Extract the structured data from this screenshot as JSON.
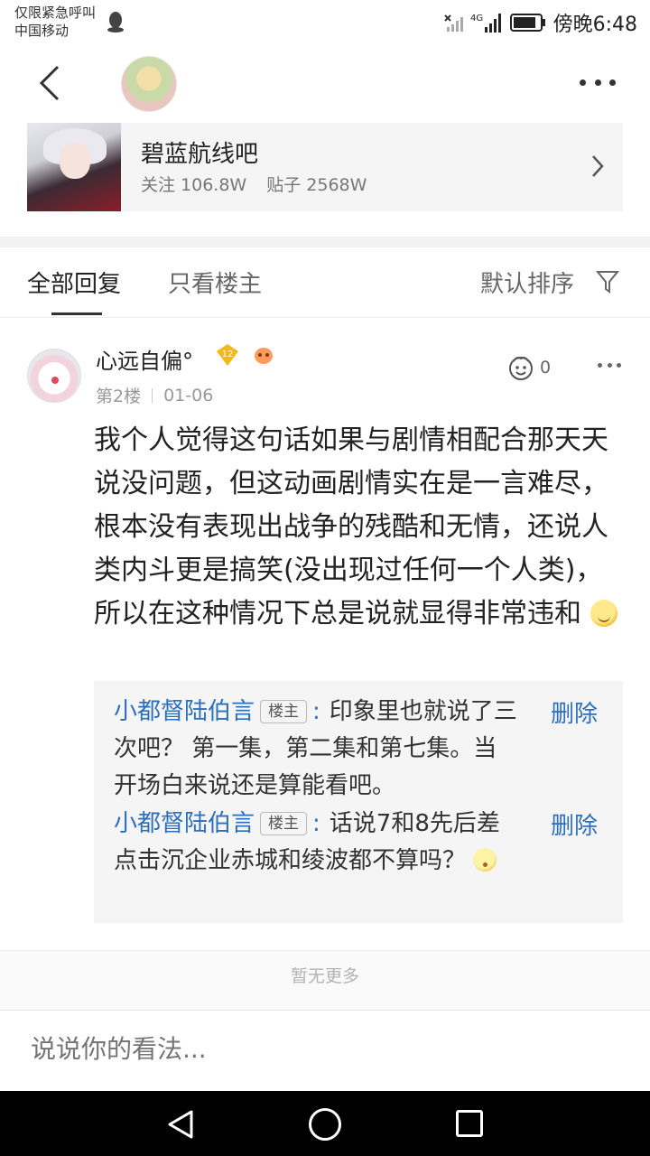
{
  "status_bar": {
    "line1": "仅限紧急呼叫",
    "line2": "中国移动",
    "network": "4G",
    "time": "傍晚6:48"
  },
  "forum": {
    "name": "碧蓝航线吧",
    "followers": "关注 106.8W",
    "posts": "贴子 2568W"
  },
  "tabs": {
    "all_replies": "全部回复",
    "op_only": "只看楼主",
    "sort": "默认排序"
  },
  "reply": {
    "username": "心远自偏°",
    "level": "12",
    "floor": "第2楼",
    "date": "01-06",
    "likes": "0",
    "content": "我个人觉得这句话如果与剧情相配合那天天说没问题，但这动画剧情实在是一言难尽，根本没有表现出战争的残酷和无情，还说人类内斗更是搞笑(没出现过任何一个人类)，所以在这种情况下总是说就显得非常违和",
    "sub_replies": [
      {
        "author": "小都督陆伯言",
        "tag": "楼主",
        "text": "印象里也就说了三次吧？ 第一集，第二集和第七集。当开场白来说还是算能看吧。",
        "delete_label": "删除"
      },
      {
        "author": "小都督陆伯言",
        "tag": "楼主",
        "text": "话说7和8先后差点击沉企业赤城和绫波都不算吗？",
        "delete_label": "删除"
      }
    ]
  },
  "footer": {
    "no_more": "暂无更多",
    "input_placeholder": "说说你的看法..."
  },
  "colors": {
    "link_blue": "#2b6fbf",
    "page_bg": "#ffffff",
    "sub_bg": "#f5f5f5"
  }
}
